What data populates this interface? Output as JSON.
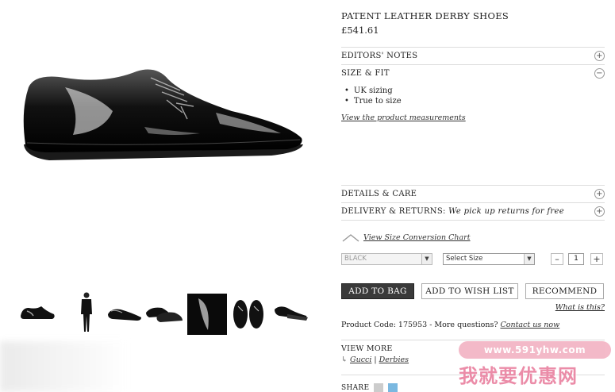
{
  "product": {
    "title": "PATENT LEATHER DERBY SHOES",
    "price": "£541.61"
  },
  "accordion": {
    "editors_notes": "EDITORS' NOTES",
    "size_fit": "SIZE & FIT",
    "size_fit_items": [
      "UK sizing",
      "True to size"
    ],
    "measurements_link": "View the product measurements",
    "details_care": "DETAILS & CARE",
    "delivery_returns": "DELIVERY & RETURNS:",
    "delivery_note": "We pick up returns for free",
    "plus_symbol": "+",
    "minus_symbol": "−"
  },
  "size_chart_link": "View Size Conversion Chart",
  "selectors": {
    "color_value": "BLACK",
    "size_placeholder": "Select Size",
    "quantity": "1",
    "qty_minus": "–",
    "qty_plus": "+"
  },
  "actions": {
    "add_to_bag": "ADD TO BAG",
    "add_to_wish_list": "ADD TO WISH LIST",
    "recommend": "RECOMMEND",
    "what_is_this": "What is this?"
  },
  "product_code": {
    "text": "Product Code: 175953 - More questions?",
    "contact_link": "Contact us now"
  },
  "view_more": {
    "title": "VIEW MORE",
    "links": [
      "Gucci",
      "Derbies"
    ],
    "separator": "|"
  },
  "share": {
    "label": "SHARE"
  },
  "watermark": {
    "url": "www.591yhw.com",
    "text": "我就要优惠网"
  },
  "icons": [
    "plus-circle-icon",
    "minus-circle-icon",
    "hanger-icon",
    "dropdown-arrow-icon",
    "return-arrow-icon",
    "share-icon",
    "twitter-icon"
  ],
  "colors": {
    "button_dark": "#3a3a3a",
    "watermark_pink": "#f3b4c4",
    "watermark_text": "#e8799a"
  }
}
